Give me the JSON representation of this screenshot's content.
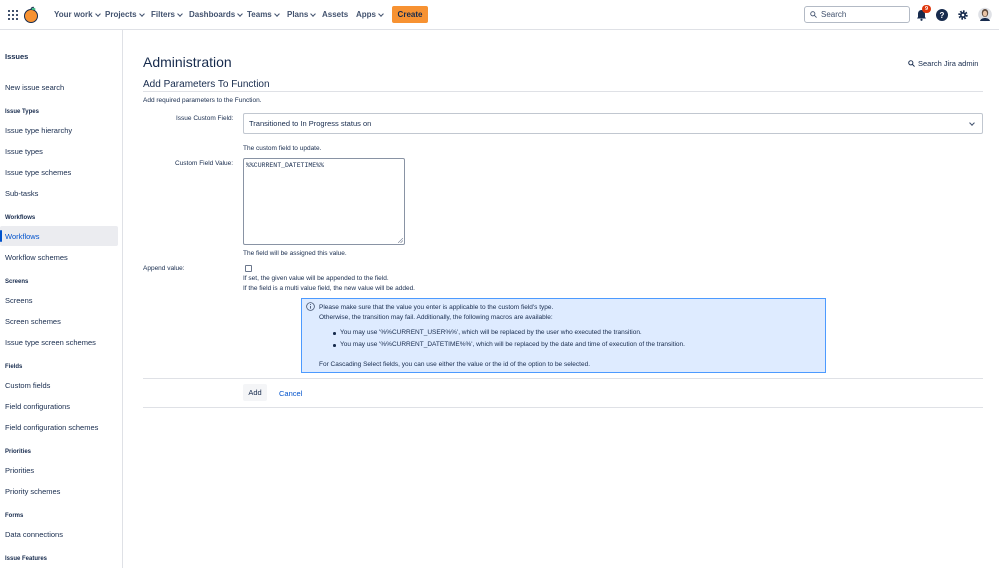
{
  "topnav": {
    "items": [
      {
        "label": "Your work",
        "dropdown": true
      },
      {
        "label": "Projects",
        "dropdown": true
      },
      {
        "label": "Filters",
        "dropdown": true
      },
      {
        "label": "Dashboards",
        "dropdown": true
      },
      {
        "label": "Teams",
        "dropdown": true
      },
      {
        "label": "Plans",
        "dropdown": true
      },
      {
        "label": "Assets",
        "dropdown": false
      },
      {
        "label": "Apps",
        "dropdown": true
      }
    ],
    "create_label": "Create",
    "search_placeholder": "Search",
    "notification_count": "9",
    "help_glyph": "?",
    "accent_color": "#f79232"
  },
  "sidebar": {
    "title": "Issues",
    "new_issue_search": "New issue search",
    "sections": [
      {
        "heading": "Issue Types",
        "items": [
          "Issue type hierarchy",
          "Issue types",
          "Issue type schemes",
          "Sub-tasks"
        ]
      },
      {
        "heading": "Workflows",
        "items": [
          "Workflows",
          "Workflow schemes"
        ]
      },
      {
        "heading": "Screens",
        "items": [
          "Screens",
          "Screen schemes",
          "Issue type screen schemes"
        ]
      },
      {
        "heading": "Fields",
        "items": [
          "Custom fields",
          "Field configurations",
          "Field configuration schemes"
        ]
      },
      {
        "heading": "Priorities",
        "items": [
          "Priorities",
          "Priority schemes"
        ]
      },
      {
        "heading": "Forms",
        "items": [
          "Data connections"
        ]
      },
      {
        "heading": "Issue Features",
        "items": []
      }
    ],
    "active_item": "Workflows"
  },
  "main": {
    "page_title": "Administration",
    "search_admin": "Search Jira admin",
    "section_title": "Add Parameters To Function",
    "description": "Add required parameters to the Function.",
    "custom_field_label": "Issue Custom Field:",
    "custom_field_value": "Transitioned to In Progress status on",
    "custom_field_help": "The custom field to update.",
    "value_label": "Custom Field Value:",
    "value_text": "%%CURRENT_DATETIME%%",
    "value_help": "The field will be assigned this value.",
    "append_label": "Append value:",
    "append_checked": false,
    "append_help_1": "If set, the given value will be appended to the field.",
    "append_help_2": "If the field is a multi value field, the new value will be added.",
    "info": {
      "line1": "Please make sure that the value you enter is applicable to the custom field's type.",
      "line2": "Otherwise, the transition may fail. Additionally, the following macros are available:",
      "bullet1": "You may use '%%CURRENT_USER%%', which will be replaced by the user who executed the transition.",
      "bullet2": "You may use '%%CURRENT_DATETIME%%', which will be replaced by the date and time of execution of the transition.",
      "line3": "For Cascading Select fields, you can use either the value or the id of the option to be selected."
    },
    "add_label": "Add",
    "cancel_label": "Cancel"
  }
}
